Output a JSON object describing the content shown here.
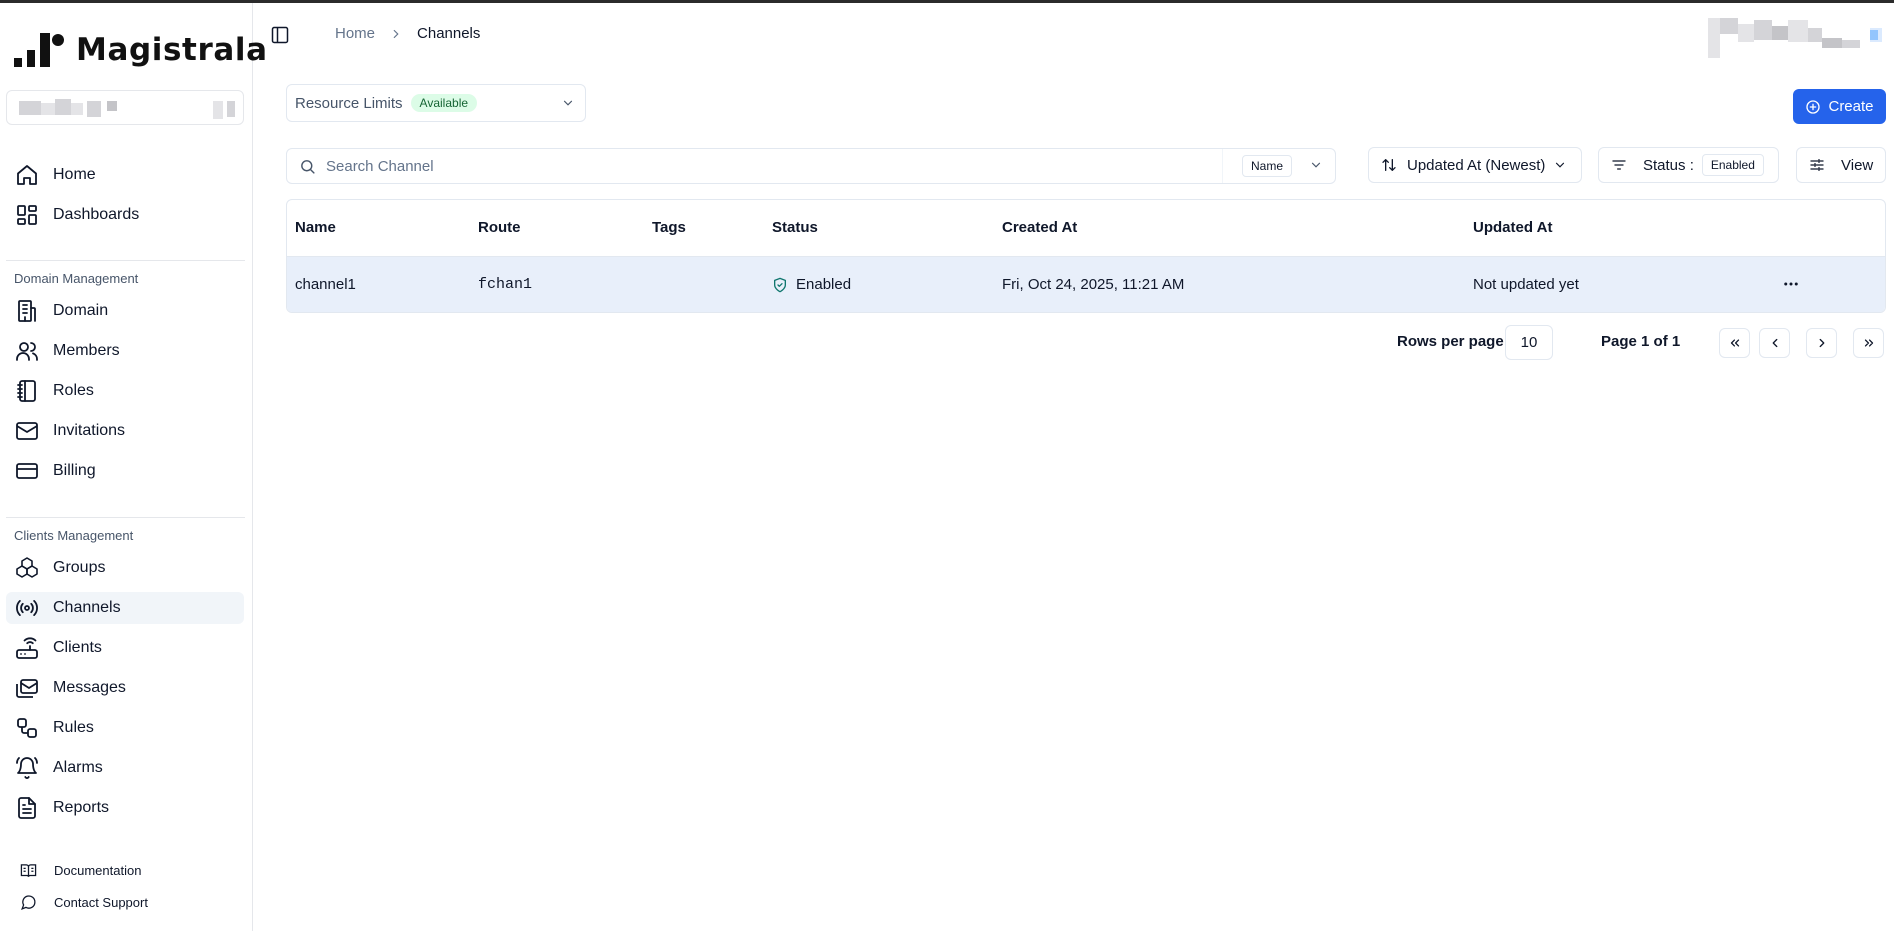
{
  "app": {
    "name": "Magistrala"
  },
  "sidebar": {
    "main_items": [
      {
        "label": "Home",
        "icon": "home-icon"
      },
      {
        "label": "Dashboards",
        "icon": "dashboards-icon"
      }
    ],
    "domain_section": {
      "title": "Domain Management",
      "items": [
        {
          "label": "Domain",
          "icon": "building-icon"
        },
        {
          "label": "Members",
          "icon": "users-icon"
        },
        {
          "label": "Roles",
          "icon": "notebook-icon"
        },
        {
          "label": "Invitations",
          "icon": "mail-icon"
        },
        {
          "label": "Billing",
          "icon": "credit-card-icon"
        }
      ]
    },
    "clients_section": {
      "title": "Clients Management",
      "items": [
        {
          "label": "Groups",
          "icon": "boxes-icon"
        },
        {
          "label": "Channels",
          "icon": "radio-icon",
          "active": true
        },
        {
          "label": "Clients",
          "icon": "router-icon"
        },
        {
          "label": "Messages",
          "icon": "mails-icon"
        },
        {
          "label": "Rules",
          "icon": "workflow-icon"
        },
        {
          "label": "Alarms",
          "icon": "bell-ring-icon"
        },
        {
          "label": "Reports",
          "icon": "file-text-icon"
        }
      ]
    },
    "footer": [
      {
        "label": "Documentation",
        "icon": "book-icon"
      },
      {
        "label": "Contact Support",
        "icon": "message-circle-icon"
      }
    ]
  },
  "breadcrumb": {
    "home": "Home",
    "current": "Channels"
  },
  "resource_limits": {
    "label": "Resource Limits",
    "badge": "Available"
  },
  "create_button": {
    "label": "Create"
  },
  "search": {
    "placeholder": "Search Channel",
    "field": "Name"
  },
  "sort": {
    "label": "Updated At (Newest)"
  },
  "status_filter": {
    "label": "Status :",
    "value": "Enabled"
  },
  "view_button": {
    "label": "View"
  },
  "table": {
    "headers": [
      "Name",
      "Route",
      "Tags",
      "Status",
      "Created At",
      "Updated At"
    ],
    "rows": [
      {
        "name": "channel1",
        "route": "fchan1",
        "tags": "",
        "status": "Enabled",
        "created_at": "Fri, Oct 24, 2025, 11:21 AM",
        "updated_at": "Not updated yet"
      }
    ]
  },
  "pagination": {
    "rows_label": "Rows per page",
    "rows_value": "10",
    "page_label": "Page 1 of 1"
  },
  "colors": {
    "primary": "#2563eb",
    "badge_green_bg": "#dcfce7",
    "badge_green_text": "#166534",
    "selected_row": "#e8effa"
  }
}
